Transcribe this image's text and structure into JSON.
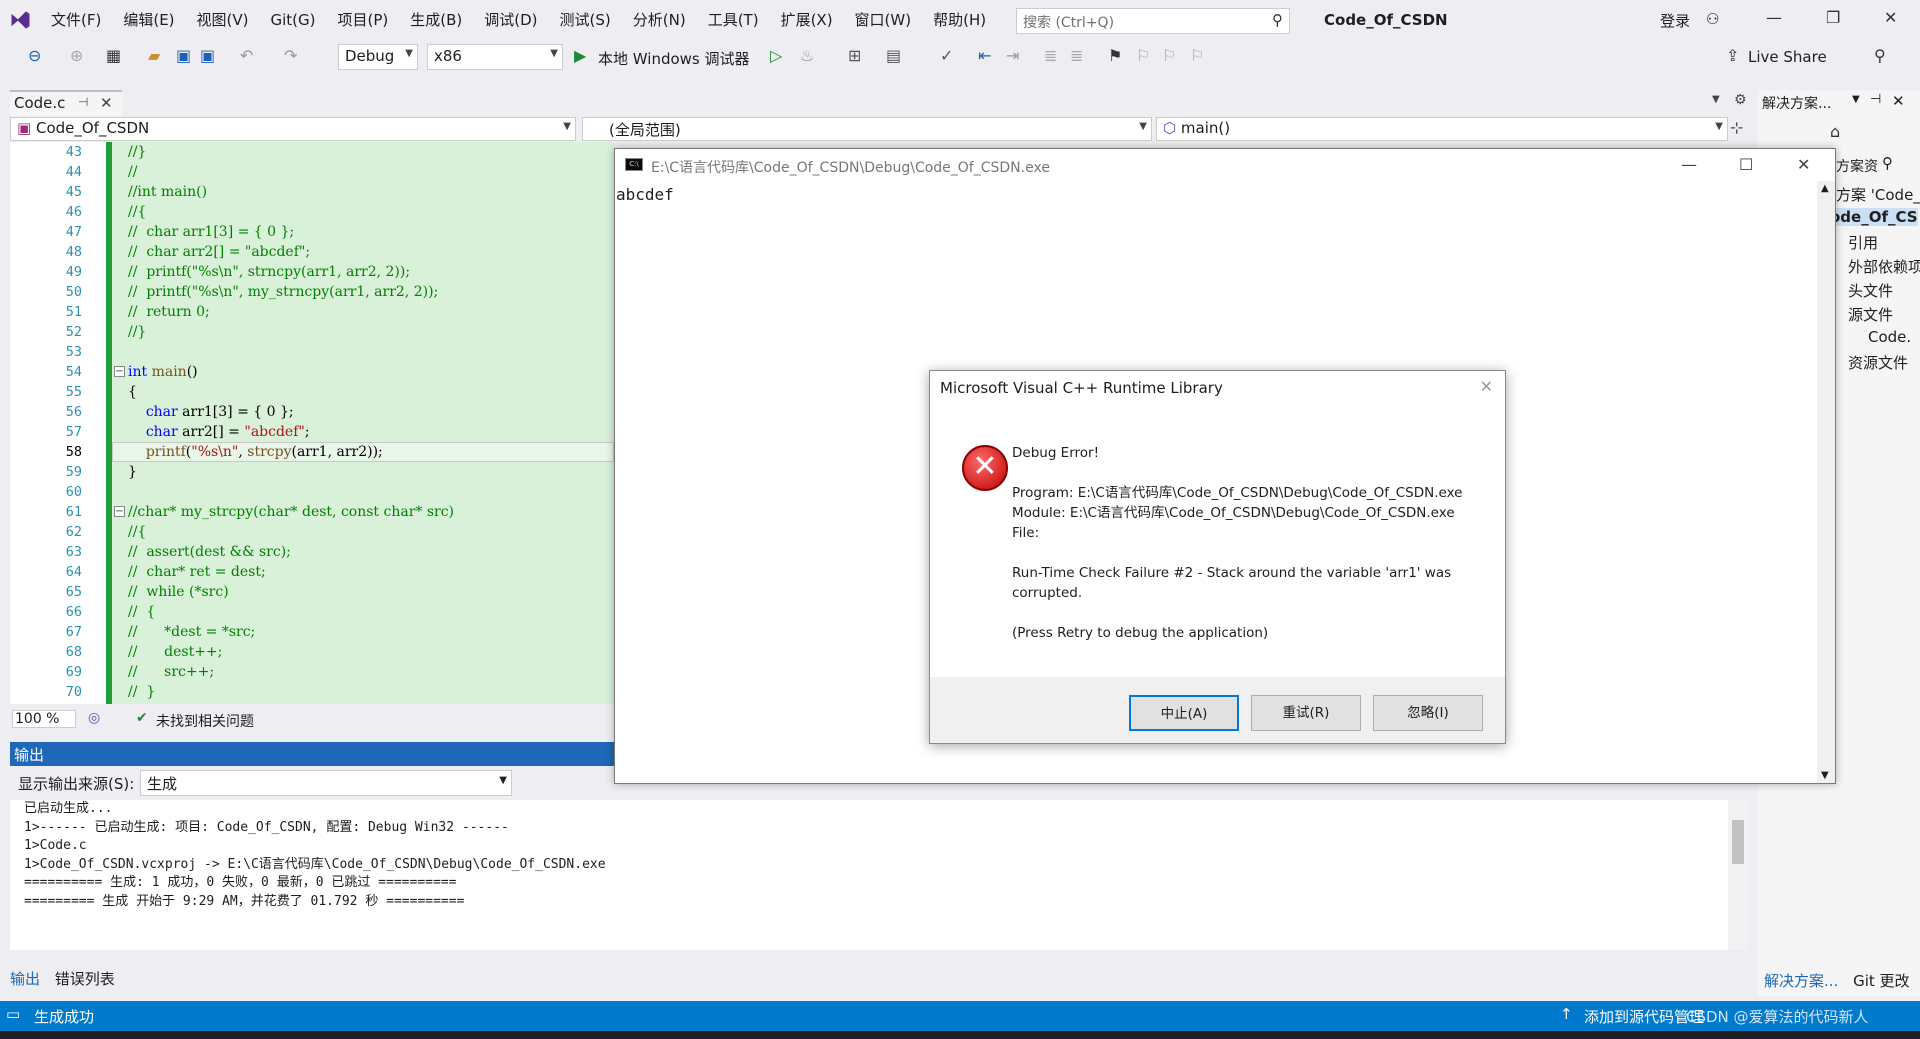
{
  "menu": [
    "文件(F)",
    "编辑(E)",
    "视图(V)",
    "Git(G)",
    "项目(P)",
    "生成(B)",
    "调试(D)",
    "测试(S)",
    "分析(N)",
    "工具(T)",
    "扩展(X)",
    "窗口(W)",
    "帮助(H)"
  ],
  "search_placeholder": "搜索 (Ctrl+Q)",
  "solution_title": "Code_Of_CSDN",
  "login": "登录",
  "toolbar": {
    "config": "Debug",
    "platform": "x86",
    "run_label": "本地 Windows 调试器",
    "live_share": "Live Share"
  },
  "doc_tab": "Code.c",
  "nav": {
    "project": "Code_Of_CSDN",
    "scope": "(全局范围)",
    "member": "main()"
  },
  "editor": {
    "line_numbers": [
      "43",
      "44",
      "45",
      "46",
      "47",
      "48",
      "49",
      "50",
      "51",
      "52",
      "53",
      "54",
      "55",
      "56",
      "57",
      "58",
      "59",
      "60",
      "61",
      "62",
      "63",
      "64",
      "65",
      "66",
      "67",
      "68",
      "69",
      "70"
    ],
    "zoom": "100 %",
    "issues": "未找到相关问题"
  },
  "output": {
    "title": "输出",
    "source_label": "显示输出来源(S):",
    "source_value": "生成",
    "lines": [
      "已启动生成...",
      "1>------ 已启动生成: 项目: Code_Of_CSDN, 配置: Debug Win32 ------",
      "1>Code.c",
      "1>Code_Of_CSDN.vcxproj -> E:\\C语言代码库\\Code_Of_CSDN\\Debug\\Code_Of_CSDN.exe",
      "========== 生成: 1 成功，0 失败，0 最新，0 已跳过 ==========",
      "========= 生成 开始于 9:29 AM，并花费了 01.792 秒 =========="
    ],
    "tabs": [
      "输出",
      "错误列表"
    ]
  },
  "solution_explorer": {
    "header": "解决方案...",
    "search": "方案资",
    "items": [
      "方案 'Code_",
      "ode_Of_CS",
      "引用",
      "外部依赖项",
      "头文件",
      "源文件",
      "Code.",
      "资源文件"
    ],
    "tabs": [
      "解决方案...",
      "Git 更改"
    ]
  },
  "console": {
    "title": "E:\\C语言代码库\\Code_Of_CSDN\\Debug\\Code_Of_CSDN.exe",
    "output": "abcdef"
  },
  "dialog": {
    "title": "Microsoft Visual C++ Runtime Library",
    "heading": "Debug Error!",
    "program": "Program: E:\\C语言代码库\\Code_Of_CSDN\\Debug\\Code_Of_CSDN.exe",
    "module": "Module: E:\\C语言代码库\\Code_Of_CSDN\\Debug\\Code_Of_CSDN.exe",
    "file": "File:",
    "message1": "Run-Time Check Failure #2 - Stack around the variable 'arr1' was",
    "message2": "corrupted.",
    "hint": "(Press Retry to debug the application)",
    "abort": "中止(A)",
    "retry": "重试(R)",
    "ignore": "忽略(I)"
  },
  "status": {
    "build": "生成成功",
    "source_control": "添加到源代码管理",
    "watermark": "CSDN @爱算法的代码新人"
  }
}
